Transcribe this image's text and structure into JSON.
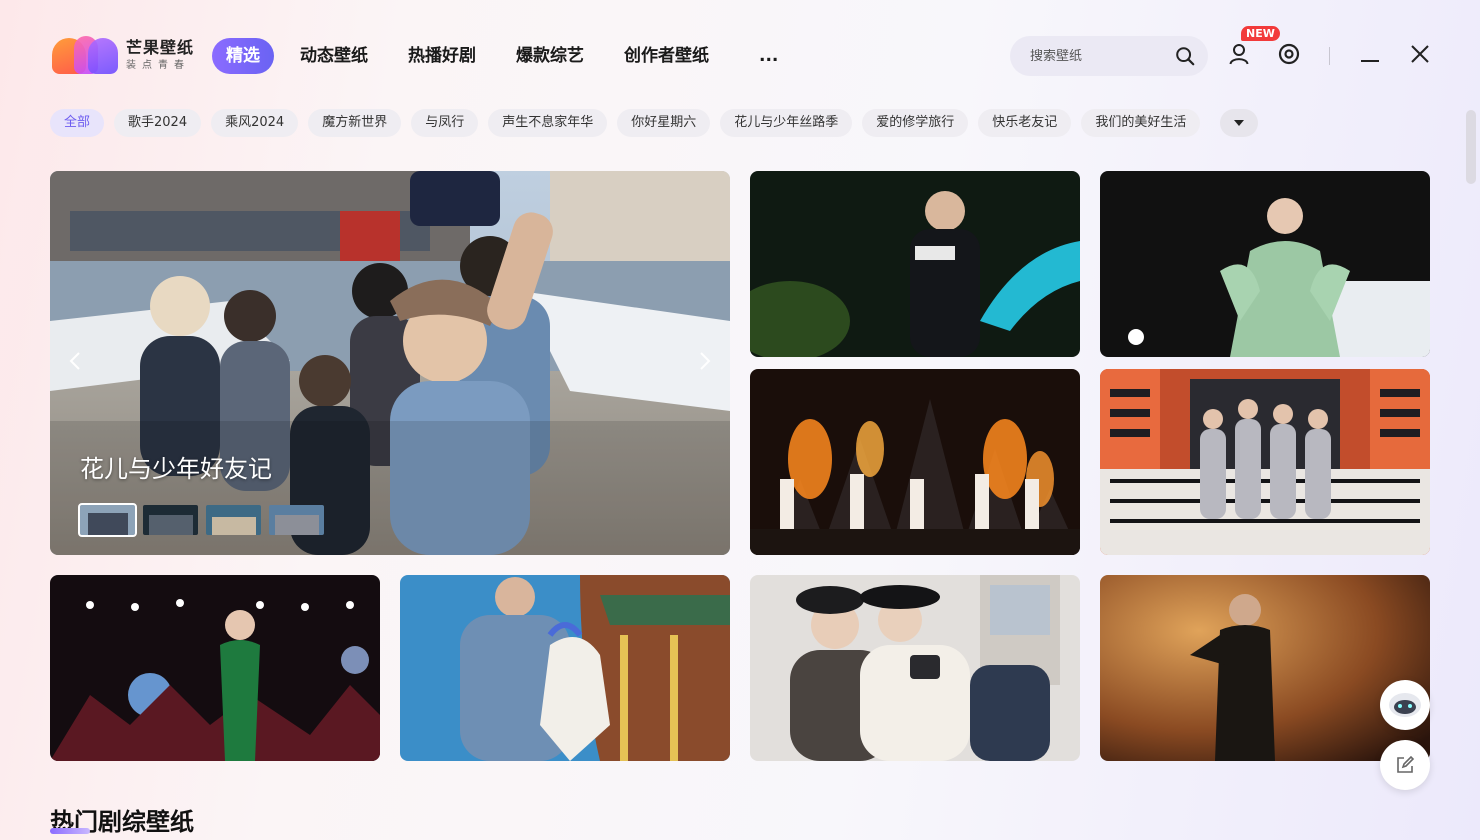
{
  "app": {
    "logo_title": "芒果壁纸",
    "logo_subtitle": "装点青春"
  },
  "nav": {
    "items": [
      {
        "label": "精选",
        "active": true
      },
      {
        "label": "动态壁纸"
      },
      {
        "label": "热播好剧"
      },
      {
        "label": "爆款综艺"
      },
      {
        "label": "创作者壁纸"
      },
      {
        "label": "..."
      }
    ]
  },
  "search": {
    "placeholder": "搜索壁纸",
    "icon": "search-icon"
  },
  "header_icons": {
    "user": "user-icon",
    "badge": "NEW",
    "settings": "settings-icon",
    "minimize": "minimize-icon",
    "close": "close-icon"
  },
  "tags": [
    {
      "label": "全部",
      "active": true
    },
    {
      "label": "歌手2024"
    },
    {
      "label": "乘风2024"
    },
    {
      "label": "魔方新世界"
    },
    {
      "label": "与凤行"
    },
    {
      "label": "声生不息家年华"
    },
    {
      "label": "你好星期六"
    },
    {
      "label": "花儿与少年丝路季"
    },
    {
      "label": "爱的修学旅行"
    },
    {
      "label": "快乐老友记"
    },
    {
      "label": "我们的美好生活"
    }
  ],
  "hero": {
    "title": "花儿与少年好友记",
    "thumb_count": 4
  },
  "section": {
    "title": "热门剧综壁纸"
  },
  "colors": {
    "accent": "#7a66f7",
    "badge_red": "#f23a3a"
  }
}
